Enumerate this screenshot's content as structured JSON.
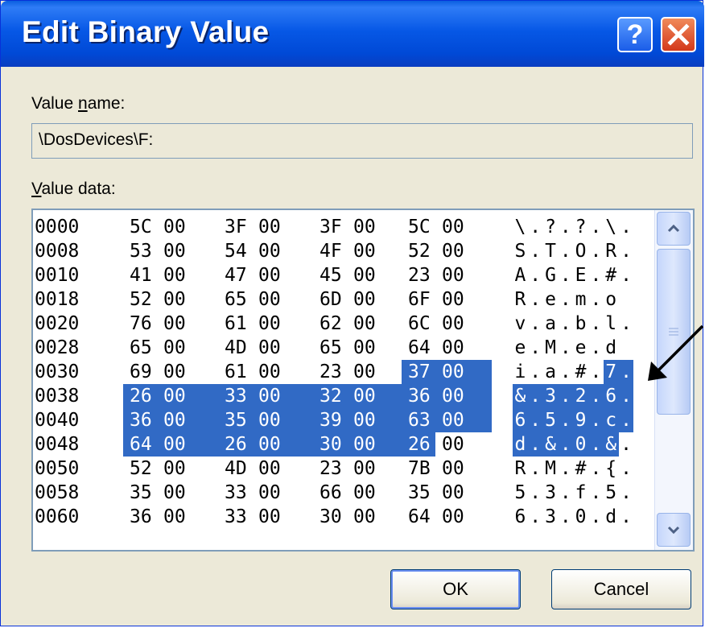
{
  "window": {
    "title": "Edit Binary Value"
  },
  "title_buttons": {
    "help": "?",
    "close": "✕"
  },
  "value_name": {
    "label_prefix": "Value ",
    "label_underlined": "n",
    "label_suffix": "ame:",
    "value": "\\DosDevices\\F:"
  },
  "value_data": {
    "label_underlined": "V",
    "label_suffix": "alue data:"
  },
  "hex_rows": [
    {
      "offset": "0000",
      "bytes": [
        "5C",
        "00",
        "3F",
        "00",
        "3F",
        "00",
        "5C",
        "00"
      ],
      "ascii": [
        "\\",
        ".",
        "?",
        ".",
        "?",
        ".",
        "\\",
        "."
      ]
    },
    {
      "offset": "0008",
      "bytes": [
        "53",
        "00",
        "54",
        "00",
        "4F",
        "00",
        "52",
        "00"
      ],
      "ascii": [
        "S",
        ".",
        "T",
        ".",
        "O",
        ".",
        "R",
        "."
      ]
    },
    {
      "offset": "0010",
      "bytes": [
        "41",
        "00",
        "47",
        "00",
        "45",
        "00",
        "23",
        "00"
      ],
      "ascii": [
        "A",
        ".",
        "G",
        ".",
        "E",
        ".",
        "#",
        "."
      ]
    },
    {
      "offset": "0018",
      "bytes": [
        "52",
        "00",
        "65",
        "00",
        "6D",
        "00",
        "6F",
        "00"
      ],
      "ascii": [
        "R",
        ".",
        "e",
        ".",
        "m",
        ".",
        "o",
        ""
      ]
    },
    {
      "offset": "0020",
      "bytes": [
        "76",
        "00",
        "61",
        "00",
        "62",
        "00",
        "6C",
        "00"
      ],
      "ascii": [
        "v",
        ".",
        "a",
        ".",
        "b",
        ".",
        "l",
        "."
      ]
    },
    {
      "offset": "0028",
      "bytes": [
        "65",
        "00",
        "4D",
        "00",
        "65",
        "00",
        "64",
        "00"
      ],
      "ascii": [
        "e",
        ".",
        "M",
        ".",
        "e",
        ".",
        "d",
        ""
      ]
    },
    {
      "offset": "0030",
      "bytes": [
        "69",
        "00",
        "61",
        "00",
        "23",
        "00",
        "37",
        "00"
      ],
      "ascii": [
        "i",
        ".",
        "a",
        ".",
        "#",
        ".",
        "7",
        "."
      ]
    },
    {
      "offset": "0038",
      "bytes": [
        "26",
        "00",
        "33",
        "00",
        "32",
        "00",
        "36",
        "00"
      ],
      "ascii": [
        "&",
        ".",
        "3",
        ".",
        "2",
        ".",
        "6",
        "."
      ]
    },
    {
      "offset": "0040",
      "bytes": [
        "36",
        "00",
        "35",
        "00",
        "39",
        "00",
        "63",
        "00"
      ],
      "ascii": [
        "6",
        ".",
        "5",
        ".",
        "9",
        ".",
        "c",
        "."
      ]
    },
    {
      "offset": "0048",
      "bytes": [
        "64",
        "00",
        "26",
        "00",
        "30",
        "00",
        "26",
        "00"
      ],
      "ascii": [
        "d",
        ".",
        "&",
        ".",
        "0",
        ".",
        "&",
        "."
      ]
    },
    {
      "offset": "0050",
      "bytes": [
        "52",
        "00",
        "4D",
        "00",
        "23",
        "00",
        "7B",
        "00"
      ],
      "ascii": [
        "R",
        ".",
        "M",
        ".",
        "#",
        ".",
        "{",
        "."
      ]
    },
    {
      "offset": "0058",
      "bytes": [
        "35",
        "00",
        "33",
        "00",
        "66",
        "00",
        "35",
        "00"
      ],
      "ascii": [
        "5",
        ".",
        "3",
        ".",
        "f",
        ".",
        "5",
        "."
      ]
    },
    {
      "offset": "0060",
      "bytes": [
        "36",
        "00",
        "33",
        "00",
        "30",
        "00",
        "64",
        "00"
      ],
      "ascii": [
        "6",
        ".",
        "3",
        ".",
        "0",
        ".",
        "d",
        "."
      ]
    }
  ],
  "selection": {
    "start_offset": "0036",
    "end_offset": "004E",
    "color": "#316ac5"
  },
  "scrollbar": {
    "up_icon": "scroll-up-icon",
    "down_icon": "scroll-down-icon",
    "grip_icon": "grip-icon"
  },
  "buttons": {
    "ok": "OK",
    "cancel": "Cancel"
  },
  "colors": {
    "titlebar": "#0058e6",
    "dialog_bg": "#ece9d8",
    "selection": "#316ac5",
    "close_button": "#d3391b"
  }
}
